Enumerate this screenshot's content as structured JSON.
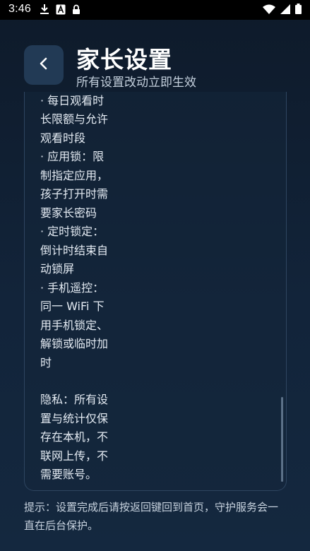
{
  "status_bar": {
    "time": "3:46",
    "left_icons": [
      "download-icon",
      "keyboard-a-icon",
      "lock-icon"
    ],
    "right_icons": [
      "wifi-icon",
      "signal-icon",
      "battery-icon"
    ]
  },
  "header": {
    "back_symbol": "<",
    "title": "家长设置",
    "subtitle": "所有设置改动立即生效"
  },
  "card": {
    "cut_line": "· 每日观看时",
    "lines": [
      "长限额与允许",
      "观看时段",
      "· 应用锁：限",
      "制指定应用，",
      "孩子打开时需",
      "要家长密码",
      "· 定时锁定：",
      "倒计时结束自",
      "动锁屏",
      "· 手机遥控：",
      "同一 WiFi 下",
      "用手机锁定、",
      "解锁或临时加",
      "时"
    ],
    "privacy_lines": [
      "隐私：所有设",
      "置与统计仅保",
      "存在本机，不",
      "联网上传，不",
      "需要账号。"
    ]
  },
  "footer": {
    "hint": "提示：设置完成后请按返回键回到首页，守护服务会一直在后台保护。"
  }
}
